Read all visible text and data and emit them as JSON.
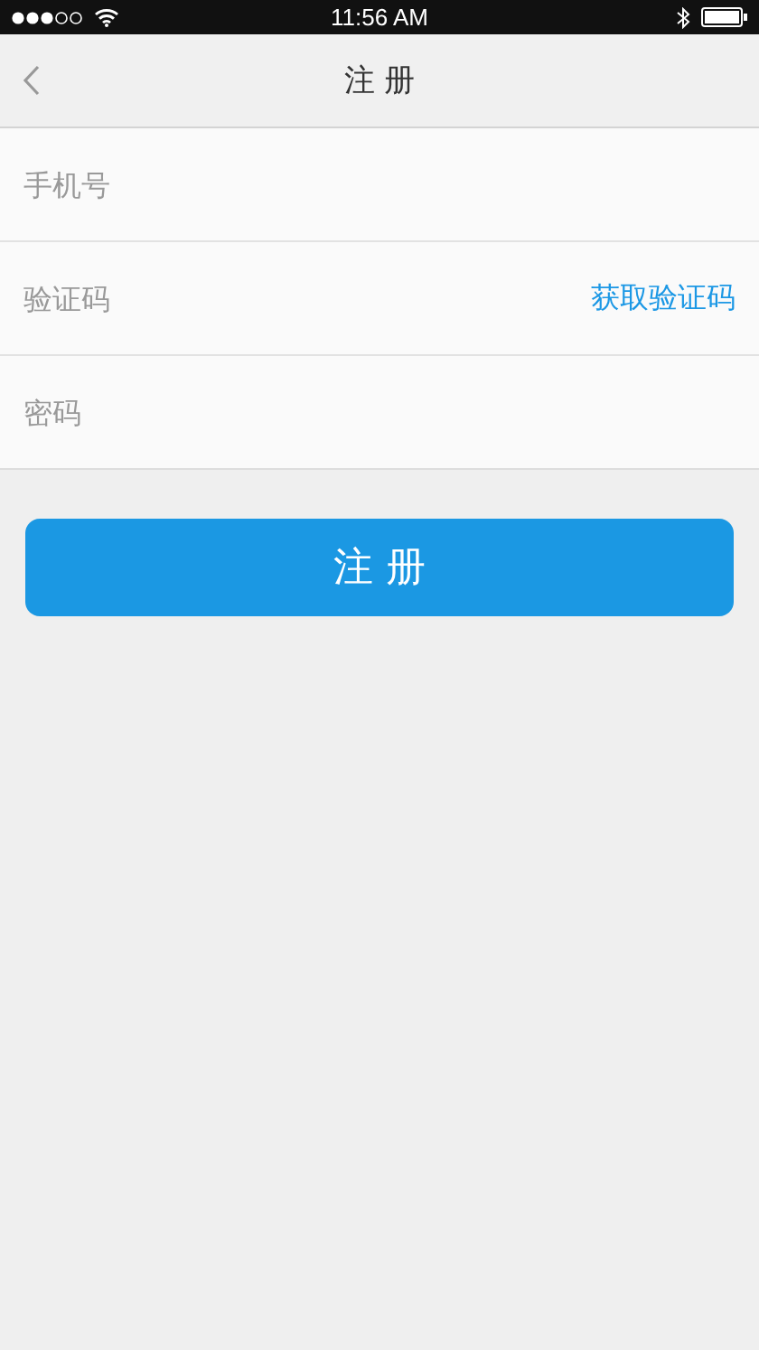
{
  "status_bar": {
    "time": "11:56 AM"
  },
  "nav_bar": {
    "title": "注 册"
  },
  "form": {
    "fields": [
      {
        "placeholder": "手机号"
      },
      {
        "placeholder": "验证码",
        "action": "获取验证码"
      },
      {
        "placeholder": "密码"
      }
    ]
  },
  "submit_button": "注 册"
}
